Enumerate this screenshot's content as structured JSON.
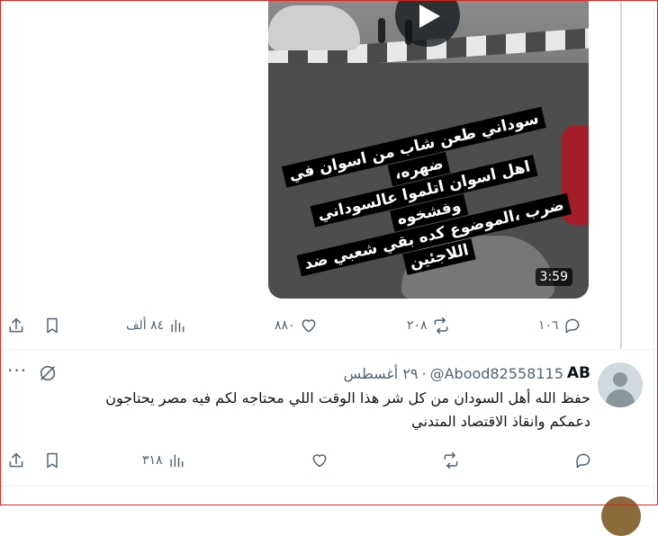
{
  "video": {
    "caption_lines": [
      "سوداني طعن شاب من اسوان في ضهره،",
      "اهل اسوان اتلموا عالسوداني وفشخوه",
      "ضرب ،الموضوع كده بقي شعبي ضد",
      "اللاجئين"
    ],
    "duration": "3:59",
    "play_icon": "play-icon"
  },
  "tweet1_actions": {
    "replies": "١٠٦",
    "reposts": "٢٠٨",
    "likes": "٨٨٠",
    "views": "٨٤ ألف"
  },
  "tweet2": {
    "name": "AB",
    "handle": "@Abood82558115",
    "dot": "·",
    "date": "٢٩ أغسطس",
    "text_line1": "حفظ الله أهل السودان من كل شر هذا الوقت اللي محتاجه لكم فيه مصر يحتاجون",
    "text_line2": "دعمكم وانقاذ الاقتصاد المتدني",
    "more": "···",
    "actions": {
      "replies": "",
      "reposts": "",
      "likes": "",
      "views": "٣١٨"
    }
  },
  "colors": {
    "text": "#0f1419",
    "secondary": "#536471",
    "frame": "#e0231c"
  }
}
